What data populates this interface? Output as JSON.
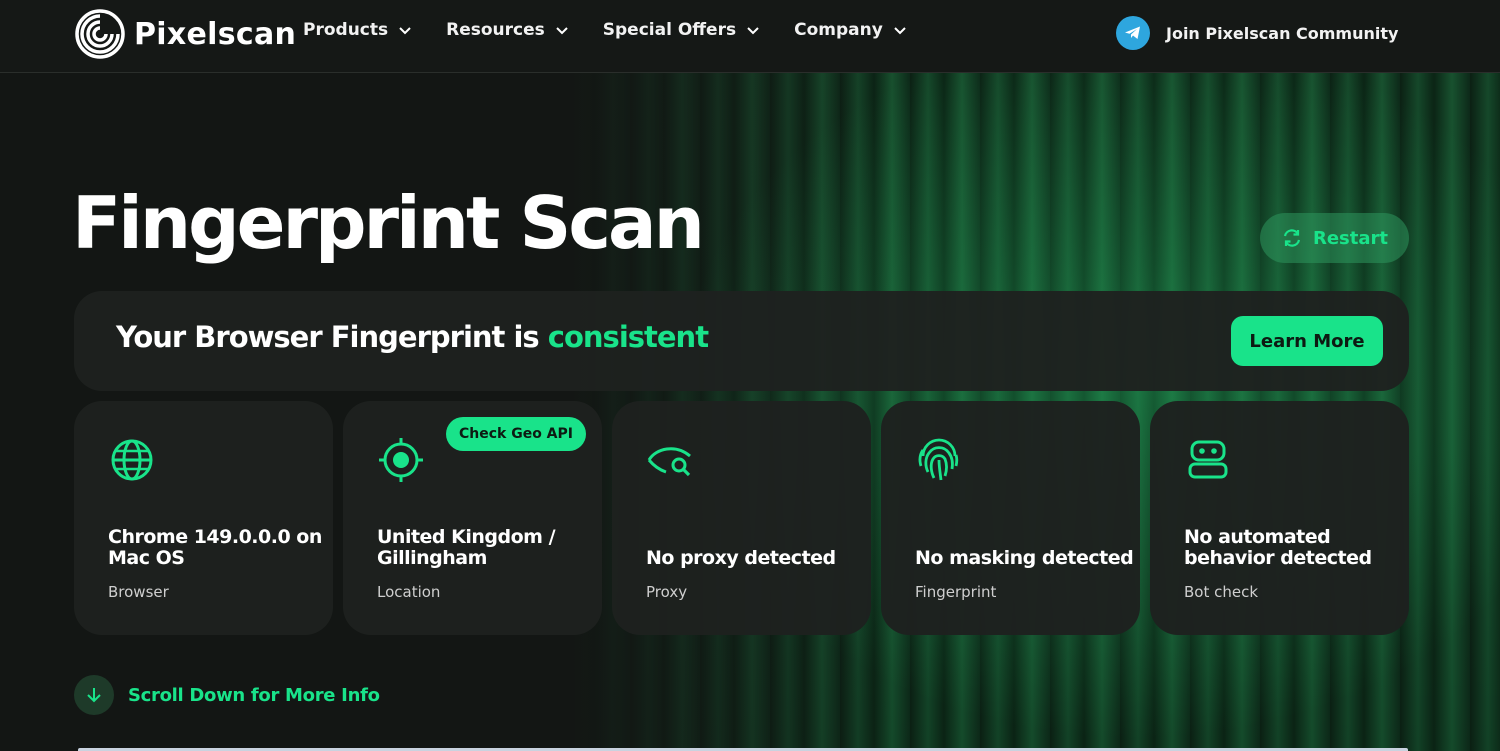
{
  "brand": {
    "name": "Pixelscan"
  },
  "nav": {
    "items": [
      {
        "label": "Products"
      },
      {
        "label": "Resources"
      },
      {
        "label": "Special Offers"
      },
      {
        "label": "Company"
      }
    ],
    "community_label": "Join Pixelscan Community"
  },
  "hero": {
    "title": "Fingerprint Scan",
    "restart_label": "Restart"
  },
  "banner": {
    "text_prefix": "Your Browser Fingerprint is",
    "status": "consistent",
    "learn_more_label": "Learn More"
  },
  "cards": [
    {
      "icon": "globe-icon",
      "value": "Chrome 149.0.0.0 on Mac OS",
      "label": "Browser"
    },
    {
      "icon": "crosshair-icon",
      "value": "United Kingdom / Gillingham",
      "label": "Location",
      "action": "Check Geo API"
    },
    {
      "icon": "eye-search-icon",
      "value": "No proxy detected",
      "label": "Proxy"
    },
    {
      "icon": "fingerprint-icon",
      "value": "No masking detected",
      "label": "Fingerprint"
    },
    {
      "icon": "robot-icon",
      "value": "No automated behavior detected",
      "label": "Bot check"
    }
  ],
  "scroll": {
    "label": "Scroll Down for More Info"
  },
  "colors": {
    "accent": "#19e38a",
    "background": "#131614",
    "card": "#1e211f",
    "telegram": "#2ea6de"
  }
}
